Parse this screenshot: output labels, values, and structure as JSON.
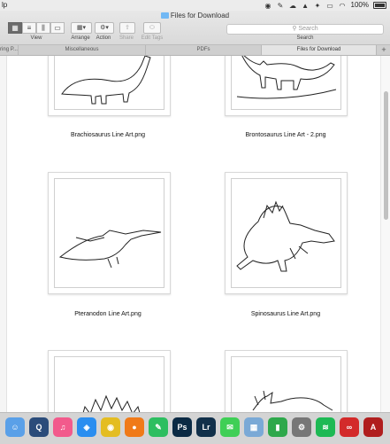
{
  "menubar": {
    "app_fragment": "lp",
    "battery_percent": "100%"
  },
  "window": {
    "title": "Files for Download"
  },
  "toolbar": {
    "view_label": "View",
    "arrange_label": "Arrange",
    "action_label": "Action",
    "share_label": "Share",
    "edit_tags_label": "Edit Tags",
    "search_placeholder": "Search",
    "search_label": "Search"
  },
  "tabs": [
    {
      "label": "ring P..."
    },
    {
      "label": "Miscellaneous"
    },
    {
      "label": "PDFs"
    },
    {
      "label": "Files for Download"
    }
  ],
  "tab_add": "+",
  "files": [
    {
      "name": "Brachiosaurus Line Art.png"
    },
    {
      "name": "Brontosaurus Line Art - 2.png"
    },
    {
      "name": "Pteranodon Line Art.png"
    },
    {
      "name": "Spinosaurus Line Art.png"
    }
  ],
  "dock": [
    {
      "name": "finder-icon",
      "color": "#5aa0e8",
      "glyph": "☺"
    },
    {
      "name": "quicktime-icon",
      "color": "#2b4c7a",
      "glyph": "Q"
    },
    {
      "name": "itunes-icon",
      "color": "#f25a8c",
      "glyph": "♫"
    },
    {
      "name": "safari-icon",
      "color": "#2a8ef0",
      "glyph": "◈"
    },
    {
      "name": "chrome-icon",
      "color": "#e4bd22",
      "glyph": "◉"
    },
    {
      "name": "firefox-icon",
      "color": "#f07a18",
      "glyph": "●"
    },
    {
      "name": "evernote-icon",
      "color": "#2dbe60",
      "glyph": "✎"
    },
    {
      "name": "photoshop-icon",
      "color": "#0b2a44",
      "glyph": "Ps"
    },
    {
      "name": "lightroom-icon",
      "color": "#11304a",
      "glyph": "Lr"
    },
    {
      "name": "messages-icon",
      "color": "#3fcf56",
      "glyph": "✉"
    },
    {
      "name": "preview-icon",
      "color": "#7aa9d6",
      "glyph": "▦"
    },
    {
      "name": "numbers-icon",
      "color": "#2ea84b",
      "glyph": "▮"
    },
    {
      "name": "system-preferences-icon",
      "color": "#777777",
      "glyph": "⚙"
    },
    {
      "name": "spotify-icon",
      "color": "#1db954",
      "glyph": "≋"
    },
    {
      "name": "creative-cloud-icon",
      "color": "#d32a2a",
      "glyph": "∞"
    },
    {
      "name": "acrobat-icon",
      "color": "#b01e1e",
      "glyph": "A"
    }
  ]
}
